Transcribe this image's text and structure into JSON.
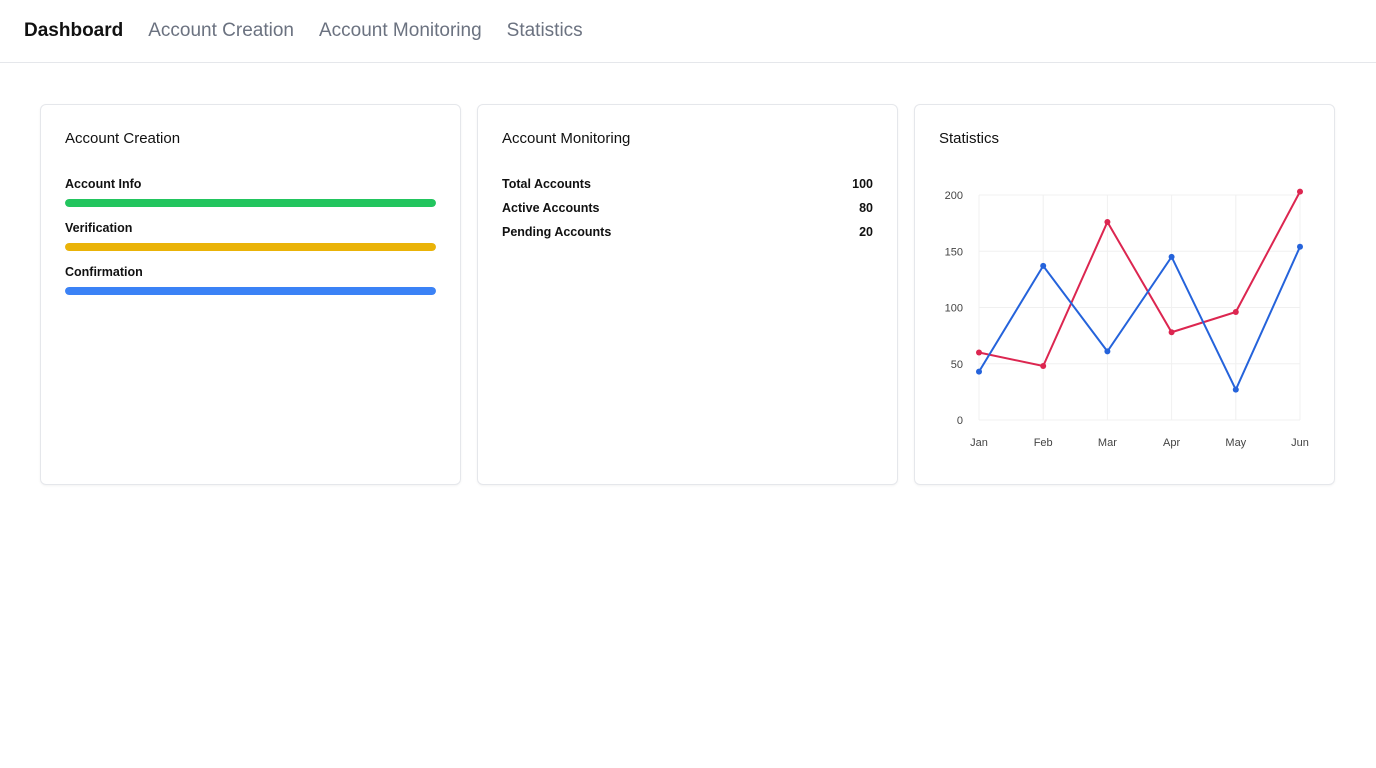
{
  "nav": {
    "items": [
      {
        "label": "Dashboard",
        "active": true
      },
      {
        "label": "Account Creation",
        "active": false
      },
      {
        "label": "Account Monitoring",
        "active": false
      },
      {
        "label": "Statistics",
        "active": false
      }
    ]
  },
  "account_creation": {
    "title": "Account Creation",
    "steps": [
      {
        "label": "Account Info",
        "color": "#22c55e",
        "progress": 1.0
      },
      {
        "label": "Verification",
        "color": "#eab308",
        "progress": 1.0
      },
      {
        "label": "Confirmation",
        "color": "#3b82f6",
        "progress": 1.0
      }
    ]
  },
  "account_monitoring": {
    "title": "Account Monitoring",
    "stats": [
      {
        "label": "Total Accounts",
        "value": "100"
      },
      {
        "label": "Active Accounts",
        "value": "80"
      },
      {
        "label": "Pending Accounts",
        "value": "20"
      }
    ]
  },
  "statistics": {
    "title": "Statistics"
  },
  "chart_data": {
    "type": "line",
    "categories": [
      "Jan",
      "Feb",
      "Mar",
      "Apr",
      "May",
      "Jun"
    ],
    "ylim": [
      0,
      200
    ],
    "yticks": [
      0,
      50,
      100,
      150,
      200
    ],
    "grid": true,
    "series": [
      {
        "color": "#dc2650",
        "values": [
          60,
          48,
          176,
          78,
          96,
          203
        ]
      },
      {
        "color": "#2563db",
        "values": [
          43,
          137,
          61,
          145,
          27,
          154
        ]
      }
    ]
  }
}
